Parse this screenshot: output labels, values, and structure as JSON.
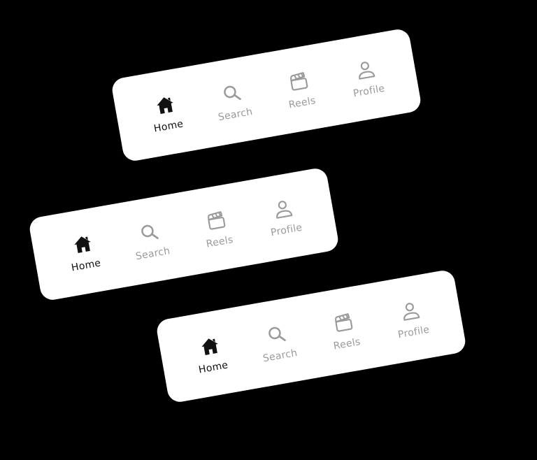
{
  "colors": {
    "background": "#000000",
    "navbar": "#ffffff",
    "active": "#111111",
    "inactive": "#9a9a9a"
  },
  "navbars": [
    {
      "items": [
        {
          "label": "Home",
          "icon": "home-icon",
          "active": true
        },
        {
          "label": "Search",
          "icon": "search-icon",
          "active": false
        },
        {
          "label": "Reels",
          "icon": "clapperboard-icon",
          "active": false
        },
        {
          "label": "Profile",
          "icon": "user-icon",
          "active": false
        }
      ]
    },
    {
      "items": [
        {
          "label": "Home",
          "icon": "home-icon",
          "active": true
        },
        {
          "label": "Search",
          "icon": "search-icon",
          "active": false
        },
        {
          "label": "Reels",
          "icon": "clapperboard-icon",
          "active": false
        },
        {
          "label": "Profile",
          "icon": "user-icon",
          "active": false
        }
      ]
    },
    {
      "items": [
        {
          "label": "Home",
          "icon": "home-icon",
          "active": true
        },
        {
          "label": "Search",
          "icon": "search-icon",
          "active": false
        },
        {
          "label": "Reels",
          "icon": "clapperboard-icon",
          "active": false
        },
        {
          "label": "Profile",
          "icon": "user-icon",
          "active": false
        }
      ]
    }
  ]
}
